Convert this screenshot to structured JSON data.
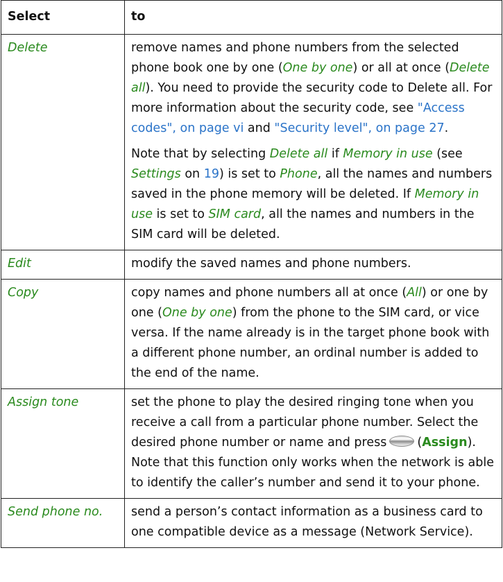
{
  "header": {
    "col1": "Select",
    "col2": "to"
  },
  "rows": [
    {
      "name": "Delete",
      "p1": {
        "a": "remove names and phone numbers from the selected phone book one by one (",
        "b": "One by one",
        "c": ") or all at once (",
        "d": "Delete all",
        "e": "). You need to provide the security code to Delete all. For more information about the security code, see ",
        "f": "\"Access codes\", on page vi",
        "g": " and ",
        "h": "\"Security level\", on page 27",
        "i": "."
      },
      "p2": {
        "a": "Note that by selecting ",
        "b": "Delete all",
        "c": " if ",
        "d": "Memory in use",
        "e": " (see ",
        "f": "Settings",
        "g": " on ",
        "h": "19",
        "i": ") is set to ",
        "j": "Phone",
        "k": ", all the names and numbers saved in the phone memory will be deleted. If ",
        "l": "Memory in use",
        "m": " is set to ",
        "n": "SIM card",
        "o": ", all the names and numbers in the SIM card will be deleted."
      }
    },
    {
      "name": "Edit",
      "text": "modify the saved names and phone numbers."
    },
    {
      "name": "Copy",
      "a": "copy names and phone numbers all at once (",
      "b": "All",
      "c": ") or one by one (",
      "d": "One by one",
      "e": ") from the phone to the SIM card, or vice versa. If the name already is in the target phone book with a different phone number, an ordinal number is added to the end of the name."
    },
    {
      "name": "Assign tone",
      "a": "set the phone to play the desired ringing tone when you receive a call from a particular phone number. Select the desired phone number or name and press",
      "key_icon": "selection-key-icon",
      "b": "(",
      "c": "Assign",
      "d": "). Note that this function only works when the network is able to identify the caller’s number and send it to your phone."
    },
    {
      "name": "Send phone no.",
      "text": "send a person’s contact information as a business card to one compatible device as a message (Network Service)."
    }
  ]
}
